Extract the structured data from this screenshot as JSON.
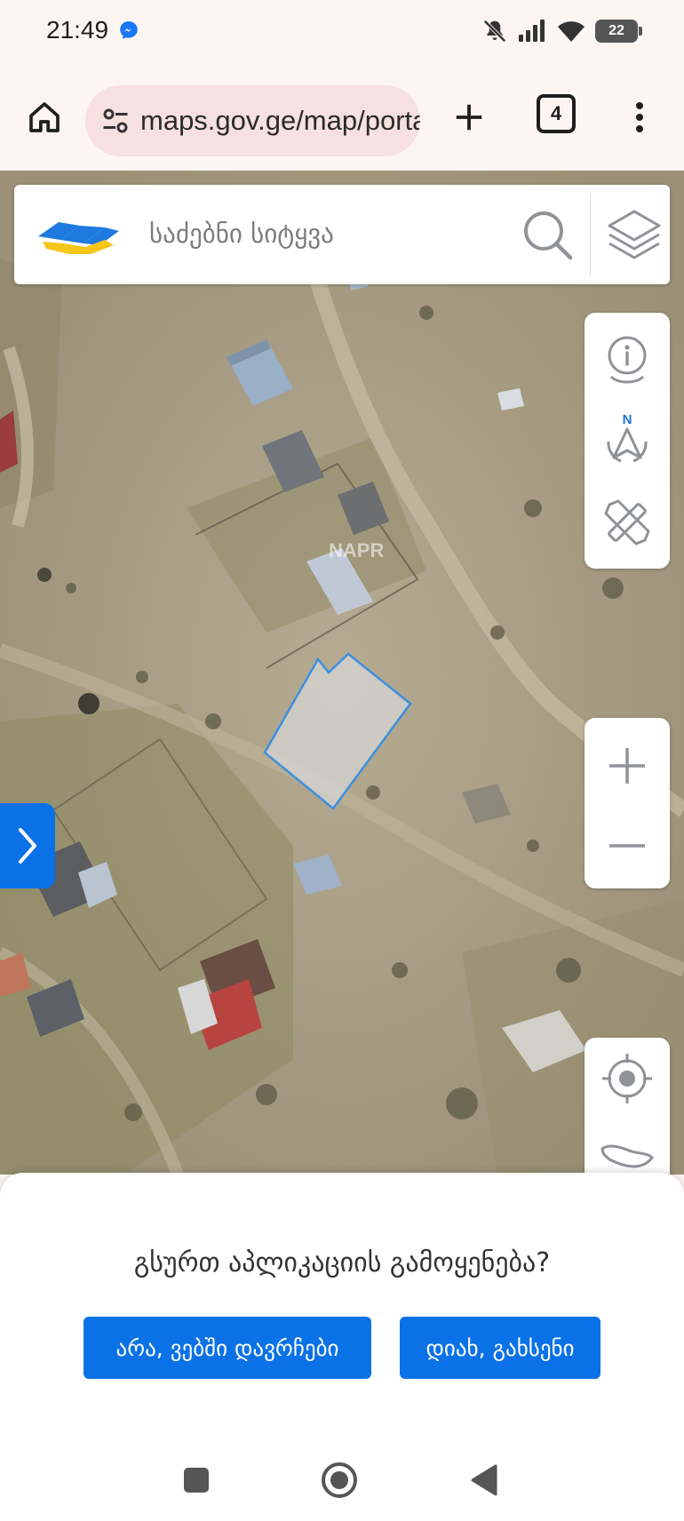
{
  "status_bar": {
    "time": "21:49",
    "battery": "22",
    "icons": [
      "messenger-icon",
      "bell-off-icon",
      "signal-icon",
      "wifi-icon",
      "battery-icon"
    ]
  },
  "browser": {
    "url": "maps.gov.ge/map/portal",
    "tab_count": "4",
    "icons": [
      "home-icon",
      "site-settings-icon",
      "new-tab-icon",
      "tabs-icon",
      "more-vert-icon"
    ]
  },
  "map": {
    "search_placeholder": "საძებნი სიტყვა",
    "watermark": "NAPR",
    "tools": [
      "info-icon",
      "compass-north-icon",
      "measure-ruler-pencil-icon"
    ],
    "compass_letter": "N",
    "zoom": [
      "zoom-in-icon",
      "zoom-out-icon"
    ],
    "location_tools": [
      "my-location-icon",
      "georgia-map-icon"
    ],
    "side_toggle_icon": "chevron-right-icon",
    "parcel_color": "#3d8fe0",
    "accent_color": "#0a72e6"
  },
  "app_prompt": {
    "question": "გსურთ აპლიკაციის გამოყენება?",
    "no_label": "არა, ვებში დავრჩები",
    "yes_label": "დიახ, გახსენი"
  },
  "nav_bar": {
    "icons": [
      "recents-square-icon",
      "home-circle-icon",
      "back-triangle-icon"
    ]
  }
}
